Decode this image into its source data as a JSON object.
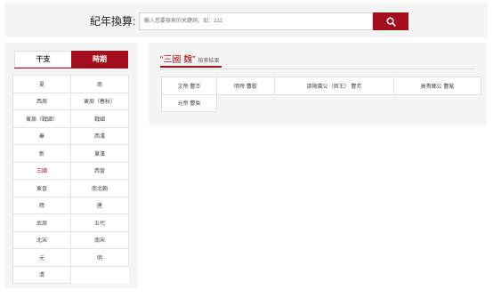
{
  "search": {
    "label": "紀年換算:",
    "placeholder": "輸入您要檢索的关鍵詞，如：212",
    "button_icon": "search-icon"
  },
  "tabs": {
    "ganzhi": "干支",
    "era": "時期",
    "active": "時期"
  },
  "eras": [
    "夏",
    "商",
    "西周",
    "東周（春秋）",
    "東周（戰國）",
    "戰國",
    "秦",
    "西漢",
    "新",
    "東漢",
    "三國",
    "西晉",
    "東晉",
    "南北朝",
    "隋",
    "唐",
    "武周",
    "五代",
    "北宋",
    "南宋",
    "元",
    "明",
    "清"
  ],
  "active_era": "三國",
  "result": {
    "keyword": "“三國 魏”",
    "suffix": "檢索結果",
    "items": [
      "文帝 曹丕",
      "明帝 曹叡",
      "邵陵厲公（齊王） 曹芳",
      "高貴鄉公 曹髦",
      "元帝 曹奐"
    ]
  },
  "colors": {
    "accent": "#a10d1a",
    "panel": "#f4f4f4",
    "border": "#e0e0e0"
  }
}
